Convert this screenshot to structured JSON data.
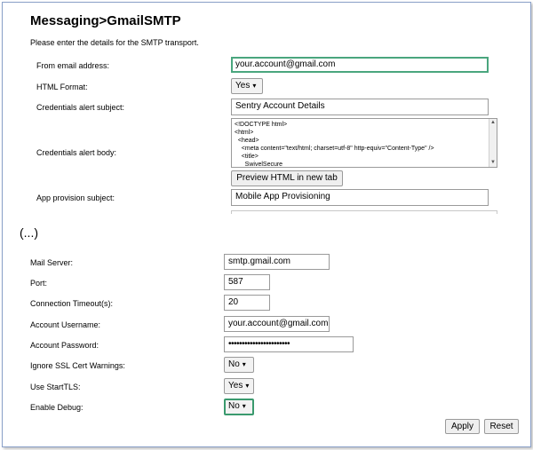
{
  "header": {
    "title": "Messaging>GmailSMTP",
    "description": "Please enter the details for the SMTP transport."
  },
  "top_form": {
    "from_email": {
      "label": "From email address:",
      "value": "your.account@gmail.com"
    },
    "html_format": {
      "label": "HTML Format:",
      "value": "Yes"
    },
    "cred_subject": {
      "label": "Credentials alert subject:",
      "value": "Sentry Account Details"
    },
    "cred_body": {
      "label": "Credentials alert body:",
      "lines": [
        "<!DOCTYPE html>",
        "<html>",
        "  <head>",
        "    <meta content=\"text/html; charset=utf-8\" http-equiv=\"Content-Type\" />",
        "    <title>",
        "      SwivelSecure"
      ]
    },
    "preview_button": "Preview HTML in new tab",
    "app_provision": {
      "label": "App provision subject:",
      "value": "Mobile App Provisioning"
    }
  },
  "ellipsis": "(...)",
  "bottom_form": {
    "mail_server": {
      "label": "Mail Server:",
      "value": "smtp.gmail.com"
    },
    "port": {
      "label": "Port:",
      "value": "587"
    },
    "timeout": {
      "label": "Connection Timeout(s):",
      "value": "20"
    },
    "username": {
      "label": "Account Username:",
      "value": "your.account@gmail.com"
    },
    "password": {
      "label": "Account Password:",
      "value": "•••••••••••••••••••••••"
    },
    "ignore_ssl": {
      "label": "Ignore SSL Cert Warnings:",
      "value": "No"
    },
    "starttls": {
      "label": "Use StartTLS:",
      "value": "Yes"
    },
    "debug": {
      "label": "Enable Debug:",
      "value": "No"
    }
  },
  "actions": {
    "apply": "Apply",
    "reset": "Reset"
  },
  "colors": {
    "focus_border": "#4aa67e",
    "frame_border": "#8aa0c8"
  }
}
